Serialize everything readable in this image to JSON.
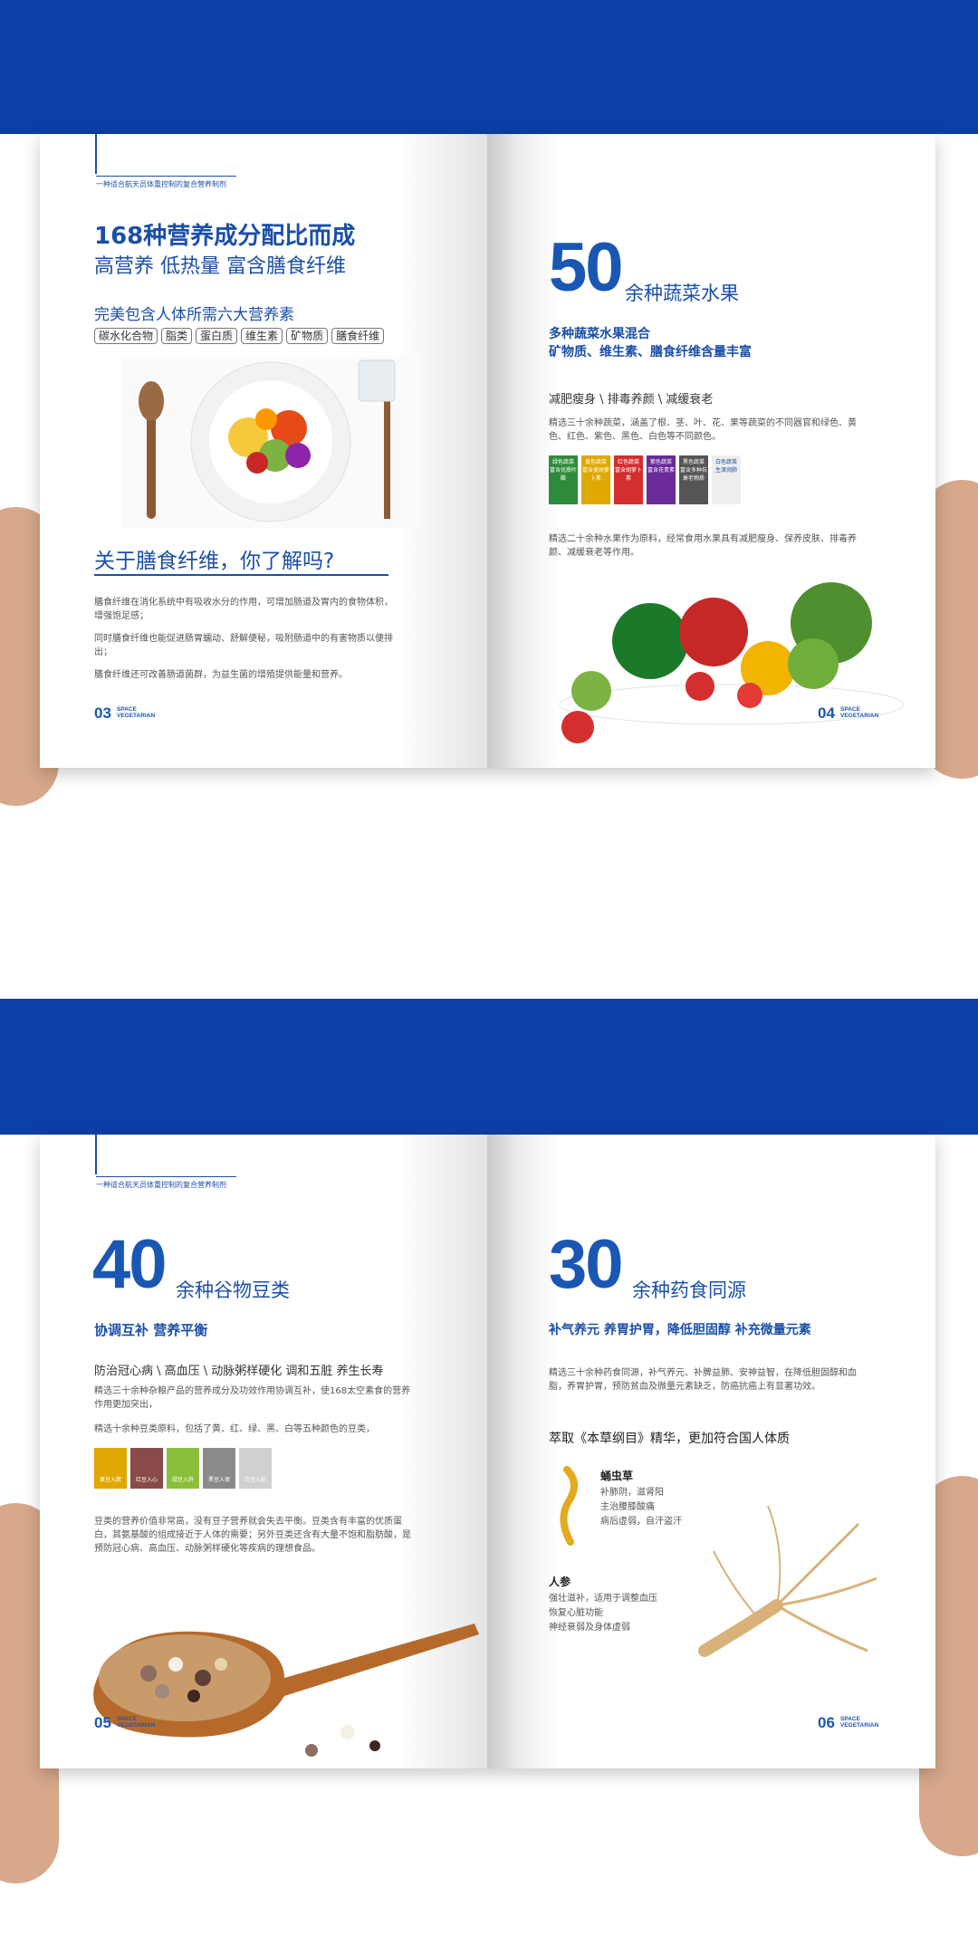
{
  "spread1": {
    "left": {
      "running_head": "一种适合航天员体重控制的复合营养制剂",
      "title_line1": "168种营养成分配比而成",
      "title_line2": "高营养 低热量 富含膳食纤维",
      "subtitle": "完美包含人体所需六大营养素",
      "tags": [
        "碳水化合物",
        "脂类",
        "蛋白质",
        "维生素",
        "矿物质",
        "膳食纤维"
      ],
      "section_title": "关于膳食纤维，你了解吗?",
      "paragraphs": [
        "膳食纤维在消化系统中有吸收水分的作用，可增加肠道及胃内的食物体积，增强饱足感；",
        "同时膳食纤维也能促进肠胃蠕动、舒解便秘，吸附肠道中的有害物质以便排出；",
        "膳食纤维还可改善肠道菌群，为益生菌的增殖提供能量和营养。"
      ],
      "page_number": "03",
      "page_label_1": "SPACE",
      "page_label_2": "VEGETARIAN"
    },
    "right": {
      "big_number": "50",
      "big_label": "余种蔬菜水果",
      "sub_line1": "多种蔬菜水果混合",
      "sub_line2": "矿物质、维生素、膳食纤维含量丰富",
      "benefits": "减肥瘦身 \\ 排毒养颜 \\ 减缓衰老",
      "desc1": "精选三十余种蔬菜，涵盖了根、茎、叶、花、果等蔬菜的不同器官和绿色、黄色、红色、紫色、黑色、白色等不同颜色。",
      "swatches": [
        {
          "title": "绿色蔬菜",
          "text": "富含优质叶酸",
          "color": "#2e8b3a"
        },
        {
          "title": "黄色蔬菜",
          "text": "富含类胡萝卜素",
          "color": "#e0a800"
        },
        {
          "title": "红色蔬菜",
          "text": "富含胡萝卜素",
          "color": "#d32f2f"
        },
        {
          "title": "紫色蔬菜",
          "text": "富含花青素",
          "color": "#6a2a9a"
        },
        {
          "title": "黑色蔬菜",
          "text": "富含多种抗衰老物质",
          "color": "#555555"
        },
        {
          "title": "白色蔬菜",
          "text": "生津润肺",
          "color": "#eeeeee"
        }
      ],
      "desc2": "精选二十余种水果作为原料，经常食用水果具有减肥瘦身、保养皮肤、排毒养颜、减缓衰老等作用。",
      "page_number": "04",
      "page_label_1": "SPACE",
      "page_label_2": "VEGETARIAN"
    }
  },
  "spread2": {
    "left": {
      "running_head": "一种适合航天员体重控制的复合营养制剂",
      "big_number": "40",
      "big_label": "余种谷物豆类",
      "subtitle": "协调互补 营养平衡",
      "benefits": "防治冠心病 \\ 高血压 \\ 动脉粥样硬化 调和五脏 养生长寿",
      "desc1": "精选三十余种杂粮产品的营养成分及功效作用协调互补，使168太空素食的营养作用更加突出，",
      "desc2": "精选十余种豆类原料，包括了黄、红、绿、黑、白等五种颜色的豆类，",
      "organs": [
        {
          "text": "黄豆入脾",
          "color": "#e0a800"
        },
        {
          "text": "红豆入心",
          "color": "#8a4a4a"
        },
        {
          "text": "绿豆入肝",
          "color": "#8bbf3a"
        },
        {
          "text": "黑豆入肾",
          "color": "#8a8a8a"
        },
        {
          "text": "白豆入肺",
          "color": "#d0d0d0"
        }
      ],
      "desc3": "豆类的营养价值非常高，没有豆子营养就会失去平衡。豆类含有丰富的优质蛋白，其氨基酸的组成接近于人体的需要；另外豆类还含有大量不饱和脂肪酸，是预防冠心病、高血压、动脉粥样硬化等疾病的理想食品。",
      "page_number": "05",
      "page_label_1": "SPACE",
      "page_label_2": "VEGETARIAN"
    },
    "right": {
      "big_number": "30",
      "big_label": "余种药食同源",
      "subtitle": "补气养元 养胃护胃，降低胆固醇 补充微量元素",
      "desc1": "精选三十余种药食同源，补气养元、补脾益肺、安神益智，在降低胆固醇和血脂，养胃护胃，预防贫血及微量元素缺乏，防癌抗癌上有显著功效。",
      "highlight": "萃取《本草纲目》精华，更加符合国人体质",
      "herb1_name": "蛹虫草",
      "herb1_desc": [
        "补肺阴，滋肾阳",
        "主治腰膝酸痛",
        "病后虚弱，自汗盗汗"
      ],
      "herb2_name": "人参",
      "herb2_desc": [
        "强壮滋补，适用于调整血压",
        "恢复心脏功能",
        "神经衰弱及身体虚弱"
      ],
      "page_number": "06",
      "page_label_1": "SPACE",
      "page_label_2": "VEGETARIAN"
    }
  }
}
